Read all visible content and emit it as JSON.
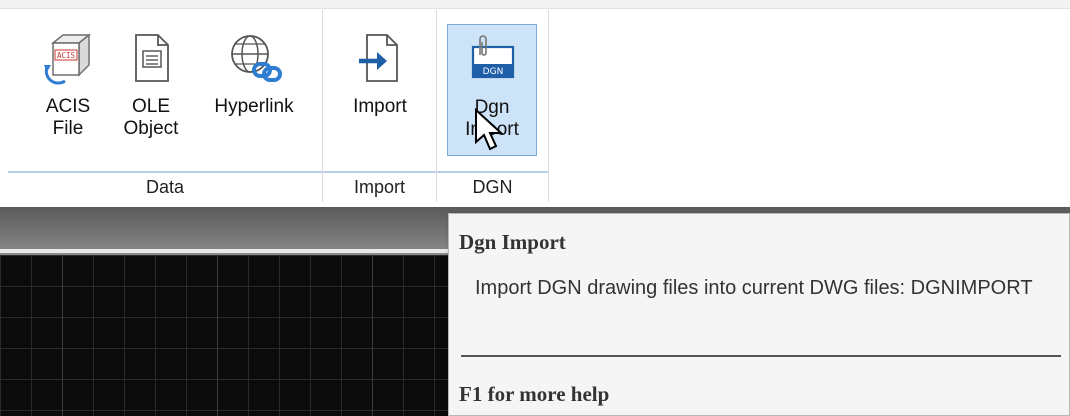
{
  "ribbon": {
    "groups": [
      {
        "title": "Data"
      },
      {
        "title": "Import"
      },
      {
        "title": "DGN"
      }
    ],
    "buttons": {
      "acis": {
        "label": "ACIS\nFile",
        "icon": "acis-file-icon",
        "icon_text": "ACIS"
      },
      "ole": {
        "label": "OLE\nObject",
        "icon": "ole-object-icon"
      },
      "hyperlink": {
        "label": "Hyperlink",
        "icon": "hyperlink-icon"
      },
      "import": {
        "label": "Import",
        "icon": "import-icon"
      },
      "dgn": {
        "label": "Dgn\nImport",
        "icon": "dgn-import-icon",
        "icon_text": "DGN",
        "active": true
      }
    }
  },
  "tooltip": {
    "title": "Dgn Import",
    "description": "Import DGN drawing files into current DWG files: DGNIMPORT",
    "help": "F1 for more help"
  },
  "colors": {
    "accent": "#1f5fa8",
    "active_bg": "#cde3f7",
    "active_border": "#7fa9d9",
    "canvas_bg": "#0b0b0b"
  }
}
